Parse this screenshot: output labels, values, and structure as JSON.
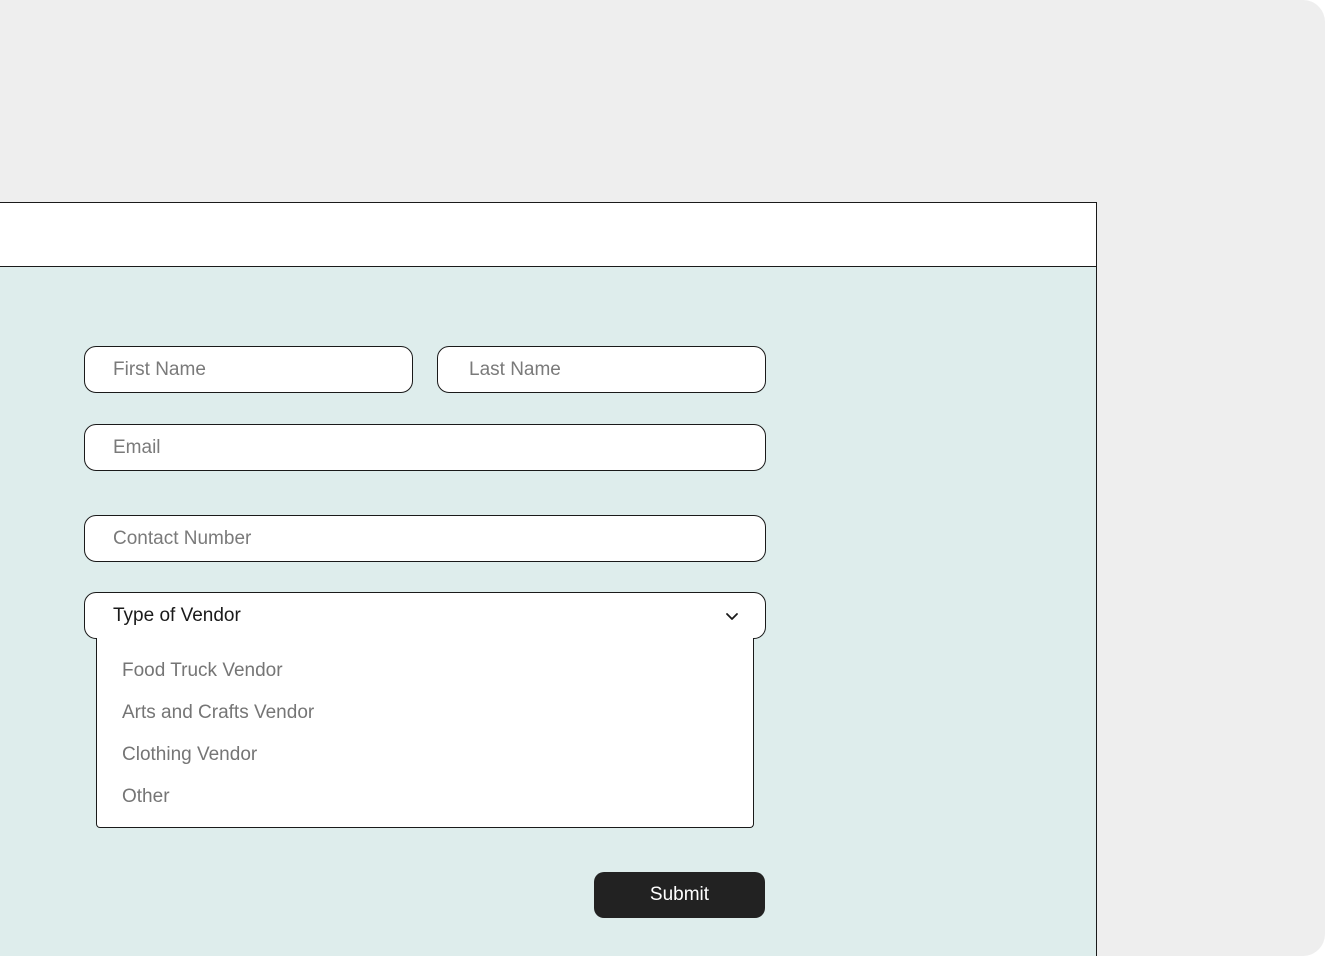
{
  "form": {
    "first_name_placeholder": "First Name",
    "last_name_placeholder": "Last Name",
    "email_placeholder": "Email",
    "contact_placeholder": "Contact Number",
    "vendor_select_label": "Type of Vendor",
    "vendor_options": [
      "Food Truck Vendor",
      "Arts and Crafts Vendor",
      "Clothing Vendor",
      "Other"
    ],
    "submit_label": "Submit"
  },
  "icons": {
    "dropdown": "chevron-down-icon"
  },
  "colors": {
    "page_background": "#eeeeee",
    "form_background": "#deedec",
    "border": "#1a1a1a",
    "submit_background": "#222222",
    "placeholder_text": "#7a7a7a"
  }
}
